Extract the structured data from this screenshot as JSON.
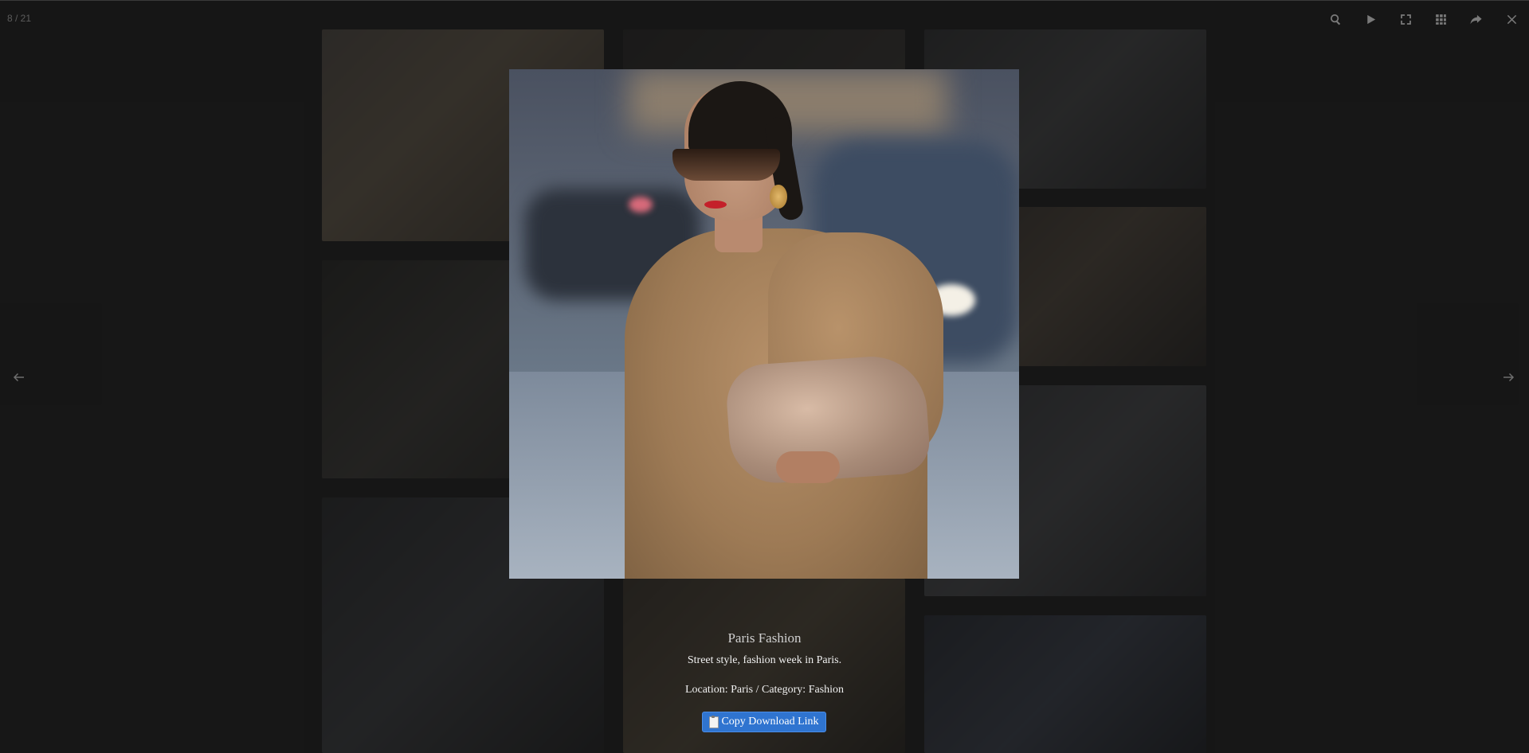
{
  "toolbar": {
    "counter": "8 / 21",
    "icons": [
      "search-icon",
      "play-icon",
      "fullscreen-icon",
      "grid-icon",
      "share-icon",
      "close-icon"
    ]
  },
  "navigation": {
    "prev_icon": "arrow-left-icon",
    "next_icon": "arrow-right-icon"
  },
  "lightbox": {
    "title": "Paris Fashion",
    "description": "Street style, fashion week in Paris.",
    "meta": "Location: Paris / Category: Fashion",
    "copy_button_label": "Copy Download Link",
    "copy_button_icon": "clipboard-icon"
  },
  "colors": {
    "overlay": "#1f1f1f",
    "accent_button": "#2f74d0",
    "toolbar_icon": "#7a7a7a"
  }
}
